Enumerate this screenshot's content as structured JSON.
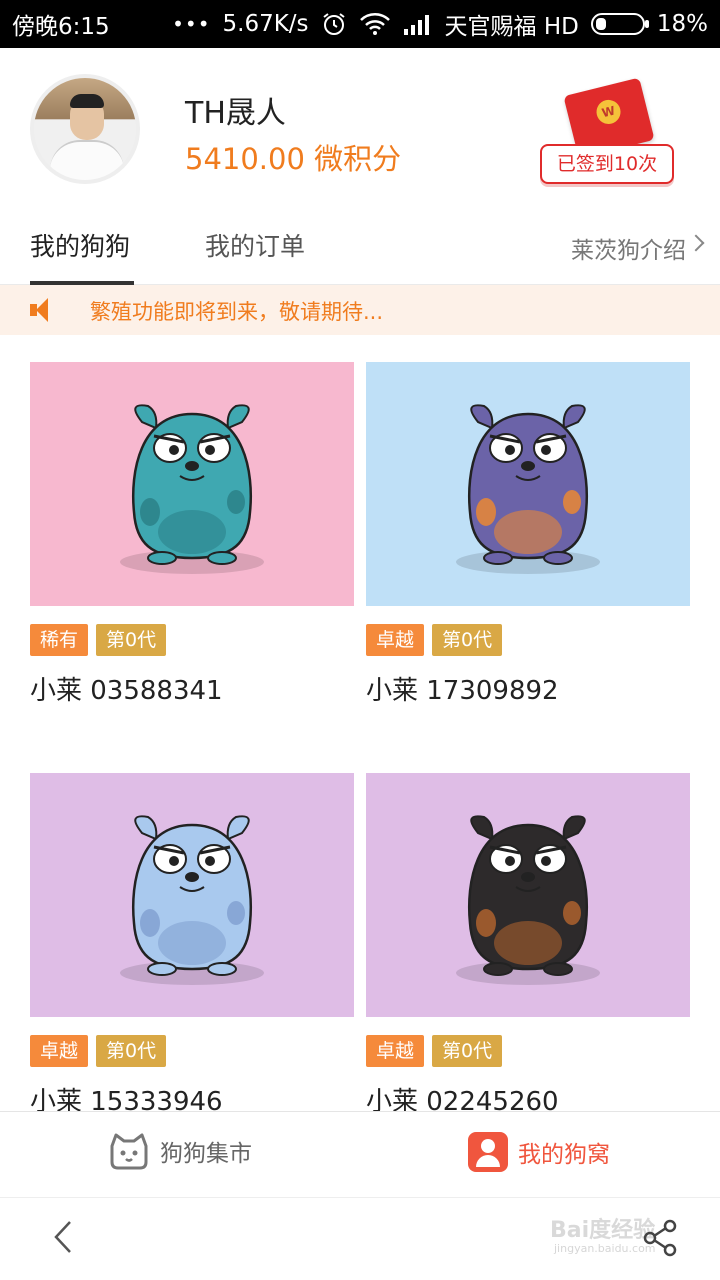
{
  "status_bar": {
    "time": "傍晚6:15",
    "dots": "•••",
    "speed": "5.67K/s",
    "carrier": "天官赐福 HD",
    "battery": "18%"
  },
  "profile": {
    "name": "TH晟人",
    "points": "5410.00 微积分",
    "checkin_label": "已签到10次",
    "redpacket_mark": "W"
  },
  "tabs": {
    "my_dogs": "我的狗狗",
    "my_orders": "我的订单",
    "intro": "莱茨狗介绍"
  },
  "notice": {
    "text": "繁殖功能即将到来，敬请期待..."
  },
  "dogs": [
    {
      "rarity": "稀有",
      "generation": "第0代",
      "name": "小莱 03588341",
      "bg": "#f7b8cf",
      "body": "#3fa8b1",
      "spots": "#2a7e86"
    },
    {
      "rarity": "卓越",
      "generation": "第0代",
      "name": "小莱 17309892",
      "bg": "#bfe0f7",
      "body": "#6b63a8",
      "spots": "#f28a2c"
    },
    {
      "rarity": "卓越",
      "generation": "第0代",
      "name": "小莱 15333946",
      "bg": "#dfbde6",
      "body": "#a9c9ee",
      "spots": "#7f9fd0"
    },
    {
      "rarity": "卓越",
      "generation": "第0代",
      "name": "小莱 02245260",
      "bg": "#dfbde6",
      "body": "#2d2a2b",
      "spots": "#b5652e"
    }
  ],
  "bottom_nav": {
    "market": "狗狗集市",
    "kennel": "我的狗窝"
  },
  "watermark": {
    "main": "Bai度经验",
    "sub": "jingyan.baidu.com"
  },
  "colors": {
    "accent_orange": "#f07c1e",
    "active_red": "#f0563e",
    "rarity_tag": "#f58a3b",
    "generation_tag": "#d9a845"
  }
}
